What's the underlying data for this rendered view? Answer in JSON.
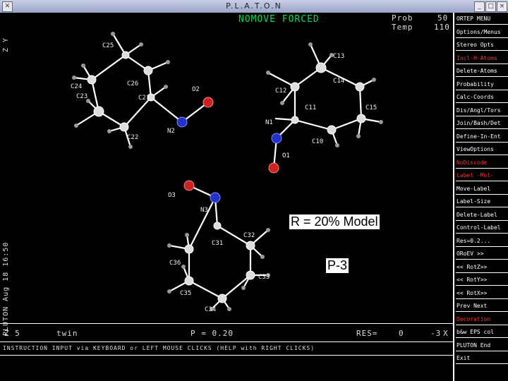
{
  "window": {
    "title": "P.L.A.T.O.N",
    "close_glyph": "✕"
  },
  "header": {
    "mode": "NOMOVE FORCED",
    "prob_label": "Prob",
    "prob_value": "50",
    "temp_label": "Temp",
    "temp_value": "110"
  },
  "left_margin": {
    "axis_label": "Z Y",
    "stamp": "PLUTON Aug 18 16:50"
  },
  "atoms": {
    "C25": "C25",
    "C24": "C24",
    "C23": "C23",
    "C26": "C26",
    "C21": "C21",
    "C22": "C22",
    "O2": "O2",
    "N2": "N2",
    "C13": "C13",
    "C14": "C14",
    "C12": "C12",
    "C11": "C11",
    "C15": "C15",
    "N1": "N1",
    "C10": "C10",
    "O1": "O1",
    "O3": "O3",
    "N3": "N3",
    "C32": "C32",
    "C31": "C31",
    "C36": "C36",
    "C33": "C33",
    "C35": "C35",
    "C34": "C34"
  },
  "overlay": {
    "model_label": "R = 20% Model",
    "space_group": "P-3"
  },
  "status": {
    "z": "Z 5",
    "mode": "twin",
    "p": "P = 0.20",
    "res_label": "RES=",
    "res_value": "0",
    "code": "-3",
    "x": "X"
  },
  "instruction": "INSTRUCTION INPUT via KEYBOARD or LEFT MOUSE CLICKS (HELP with RIGHT CLICKS)",
  "menu": [
    {
      "label": "ORTEP MENU",
      "red": false
    },
    {
      "label": "Options/Menus",
      "red": false
    },
    {
      "label": "Stereo Opts",
      "red": false
    },
    {
      "label": "Incl-H-Atoms",
      "red": true
    },
    {
      "label": "Delete-Atoms",
      "red": false
    },
    {
      "label": "Probability",
      "red": false
    },
    {
      "label": "Calc-Coords",
      "red": false
    },
    {
      "label": "Dis/Angl/Tors",
      "red": false
    },
    {
      "label": "Join/Bash/Det",
      "red": false
    },
    {
      "label": "Define-In-Ent",
      "red": false
    },
    {
      "label": "ViewOptions",
      "red": false
    },
    {
      "label": "NoDiscode",
      "red": true
    },
    {
      "label": "Label -Mol-",
      "red": true
    },
    {
      "label": "Move-Label",
      "red": false
    },
    {
      "label": "Label-Size",
      "red": false
    },
    {
      "label": "Delete-Label",
      "red": false
    },
    {
      "label": "Control-Label",
      "red": false
    },
    {
      "label": "Res=0.2...",
      "red": false
    },
    {
      "label": "ORoEV >>",
      "red": false
    },
    {
      "label": "<< RotZ>>",
      "red": false
    },
    {
      "label": "<< RotY>>",
      "red": false
    },
    {
      "label": "<< RotX>>",
      "red": false
    },
    {
      "label": "Prev   Next",
      "red": false
    },
    {
      "label": "Decoration",
      "red": true
    },
    {
      "label": "b&w EPS col",
      "red": false
    },
    {
      "label": "PLUTON End",
      "red": false
    },
    {
      "label": "Exit",
      "red": false
    }
  ]
}
